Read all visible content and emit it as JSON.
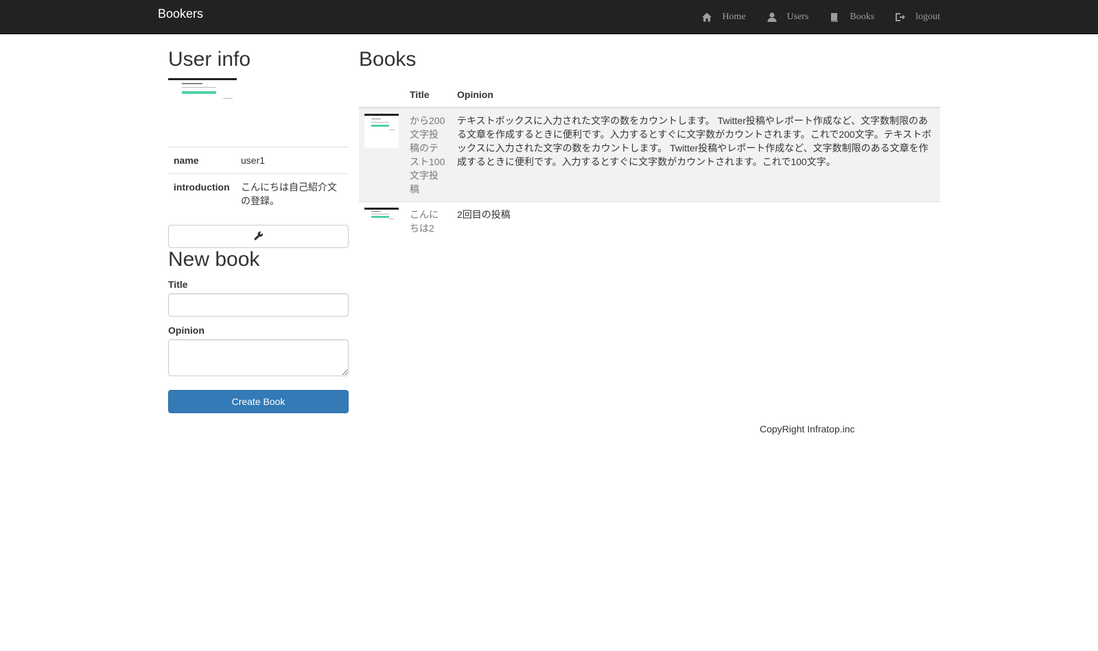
{
  "navbar": {
    "brand": "Bookers",
    "items": [
      {
        "label": "Home",
        "icon": "home-icon"
      },
      {
        "label": "Users",
        "icon": "user-icon"
      },
      {
        "label": "Books",
        "icon": "book-icon"
      },
      {
        "label": "logout",
        "icon": "logout-icon"
      }
    ]
  },
  "user_info": {
    "heading": "User info",
    "rows": [
      {
        "label": "name",
        "value": "user1"
      },
      {
        "label": "introduction",
        "value": "こんにちは自己紹介文の登録。"
      }
    ],
    "edit_icon": "wrench-icon"
  },
  "new_book": {
    "heading": "New book",
    "title_label": "Title",
    "title_value": "",
    "opinion_label": "Opinion",
    "opinion_value": "",
    "submit_label": "Create Book"
  },
  "books": {
    "heading": "Books",
    "columns": [
      "",
      "Title",
      "Opinion"
    ],
    "rows": [
      {
        "title": "から200文字投稿のテスト100文字投稿",
        "opinion": "テキストボックスに入力された文字の数をカウントします。 Twitter投稿やレポート作成など、文字数制限のある文章を作成するときに便利です。入力するとすぐに文字数がカウントされます。これで200文字。テキストボックスに入力された文字の数をカウントします。 Twitter投稿やレポート作成など、文字数制限のある文章を作成するときに便利です。入力するとすぐに文字数がカウントされます。これで100文字。"
      },
      {
        "title": "こんにちは2",
        "opinion": "2回目の投稿"
      }
    ]
  },
  "footer": {
    "copyright": "CopyRight Infratop.inc"
  },
  "colors": {
    "navbar_bg": "#222222",
    "primary_button": "#337ab7",
    "stripe": "#f2f2f2"
  }
}
